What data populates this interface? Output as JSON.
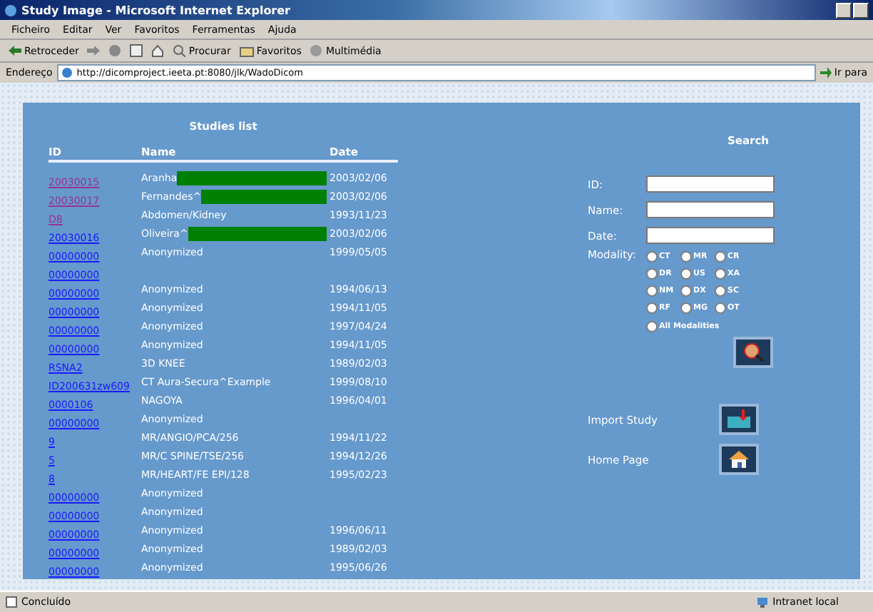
{
  "window": {
    "title": "Study Image - Microsoft Internet Explorer"
  },
  "menu": [
    "Ficheiro",
    "Editar",
    "Ver",
    "Favoritos",
    "Ferramentas",
    "Ajuda"
  ],
  "toolbar": [
    {
      "kind": "back",
      "label": "Retroceder"
    },
    {
      "kind": "forward"
    },
    {
      "kind": "stop"
    },
    {
      "kind": "refresh"
    },
    {
      "kind": "home"
    },
    {
      "kind": "search",
      "label": "Procurar"
    },
    {
      "kind": "favorites",
      "label": "Favoritos"
    },
    {
      "kind": "media",
      "label": "Multimédia"
    }
  ],
  "address": {
    "label": "Endereço",
    "url": "http://dicomproject.ieeta.pt:8080/jlk/WadoDicom",
    "go": "Ir para"
  },
  "studies": {
    "title": "Studies list",
    "columns": [
      "ID",
      "Name",
      "Date"
    ],
    "rows": [
      {
        "id": "20030015",
        "name": "Aranha",
        "redacted": true,
        "date": "2003/02/06",
        "visited": true
      },
      {
        "id": "20030017",
        "name": "Fernandes^",
        "redacted": true,
        "date": "2003/02/06",
        "visited": true
      },
      {
        "id": "D8",
        "name": "Abdomen/Kidney",
        "redacted": false,
        "date": "1993/11/23",
        "visited": true
      },
      {
        "id": "20030016",
        "name": "Oliveira^",
        "redacted": true,
        "date": "2003/02/06",
        "visited": false
      },
      {
        "id": "00000000",
        "name": "Anonymized",
        "redacted": false,
        "date": "1999/05/05",
        "visited": false
      },
      {
        "id": "00000000",
        "name": "",
        "redacted": false,
        "date": "",
        "visited": false
      },
      {
        "id": "00000000",
        "name": "Anonymized",
        "redacted": false,
        "date": "1994/06/13",
        "visited": false
      },
      {
        "id": "00000000",
        "name": "Anonymized",
        "redacted": false,
        "date": "1994/11/05",
        "visited": false
      },
      {
        "id": "00000000",
        "name": "Anonymized",
        "redacted": false,
        "date": "1997/04/24",
        "visited": false
      },
      {
        "id": "00000000",
        "name": "Anonymized",
        "redacted": false,
        "date": "1994/11/05",
        "visited": false
      },
      {
        "id": "RSNA2",
        "name": "3D KNEE",
        "redacted": false,
        "date": "1989/02/03",
        "visited": false
      },
      {
        "id": "ID200631zw609",
        "name": "CT Aura-Secura^Example",
        "redacted": false,
        "date": "1999/08/10",
        "visited": false
      },
      {
        "id": "0000106",
        "name": "NAGOYA",
        "redacted": false,
        "date": "1996/04/01",
        "visited": false
      },
      {
        "id": "00000000",
        "name": "Anonymized",
        "redacted": false,
        "date": "",
        "visited": false
      },
      {
        "id": "9",
        "name": "MR/ANGIO/PCA/256",
        "redacted": false,
        "date": "1994/11/22",
        "visited": false
      },
      {
        "id": "5",
        "name": "MR/C SPINE/TSE/256",
        "redacted": false,
        "date": "1994/12/26",
        "visited": false
      },
      {
        "id": "8",
        "name": "MR/HEART/FE EPI/128",
        "redacted": false,
        "date": "1995/02/23",
        "visited": false
      },
      {
        "id": "00000000",
        "name": "Anonymized",
        "redacted": false,
        "date": "",
        "visited": false
      },
      {
        "id": "00000000",
        "name": "Anonymized",
        "redacted": false,
        "date": "",
        "visited": false
      },
      {
        "id": "00000000",
        "name": "Anonymized",
        "redacted": false,
        "date": "1996/06/11",
        "visited": false
      },
      {
        "id": "00000000",
        "name": "Anonymized",
        "redacted": false,
        "date": "1989/02/03",
        "visited": false
      },
      {
        "id": "00000000",
        "name": "Anonymized",
        "redacted": false,
        "date": "1995/06/26",
        "visited": false
      }
    ]
  },
  "search": {
    "title": "Search",
    "fields": [
      {
        "label": "ID:"
      },
      {
        "label": "Name:"
      },
      {
        "label": "Date:"
      }
    ],
    "modality_label": "Modality:",
    "modalities": [
      {
        "label": "CT",
        "selected": false
      },
      {
        "label": "MR",
        "selected": false
      },
      {
        "label": "CR",
        "selected": false
      },
      {
        "label": "DR",
        "selected": false
      },
      {
        "label": "US",
        "selected": false
      },
      {
        "label": "XA",
        "selected": false
      },
      {
        "label": "NM",
        "selected": false
      },
      {
        "label": "DX",
        "selected": false
      },
      {
        "label": "SC",
        "selected": false
      },
      {
        "label": "RF",
        "selected": false
      },
      {
        "label": "MG",
        "selected": false
      },
      {
        "label": "OT",
        "selected": false
      }
    ],
    "all_modalities": {
      "label": "All Modalities",
      "selected": false
    }
  },
  "actions": [
    {
      "kind": "import",
      "label": "Import Study"
    },
    {
      "kind": "home",
      "label": "Home Page"
    }
  ],
  "status_bar": {
    "text": "Concluído",
    "zone": "Intranet local"
  }
}
